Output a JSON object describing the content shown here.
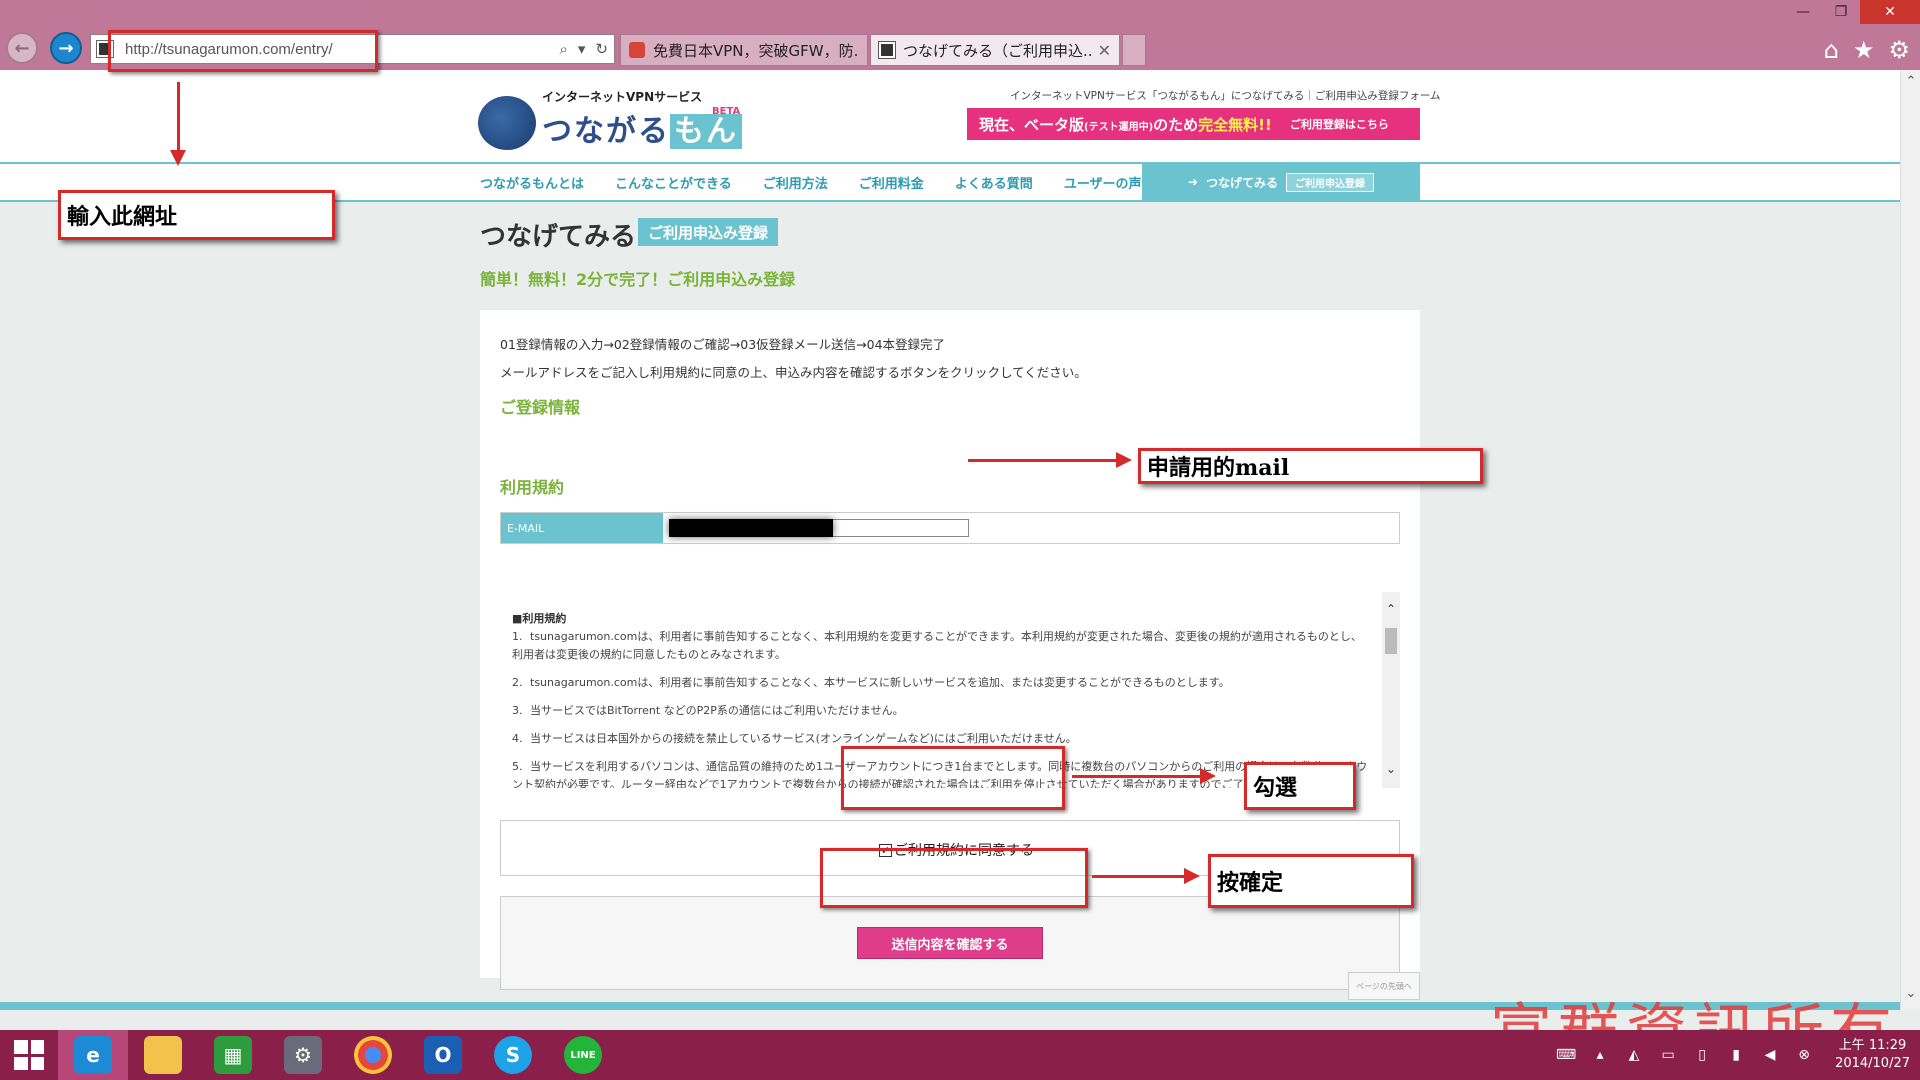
{
  "browser": {
    "url": "http://tsunagarumon.com/entry/",
    "tabs": [
      {
        "title": "免費日本VPN，突破GFW，防..."
      },
      {
        "title": "つなげてみる（ご利用申込..."
      }
    ],
    "window_controls": {
      "minimize": "—",
      "restore": "❐",
      "close": "✕"
    },
    "icons": [
      "back-icon",
      "forward-icon",
      "search-icon",
      "refresh-icon",
      "home-icon",
      "star-icon",
      "gear-icon"
    ]
  },
  "site": {
    "logo_sub": "インターネットVPNサービス",
    "logo_main_1": "つながる",
    "logo_main_2": "もん",
    "logo_beta": "BETA",
    "breadcrumb": "インターネットVPNサービス「つながるもん」につなげてみる｜ご利用申込み登録フォーム",
    "banner_1": "現在、ベータ版",
    "banner_small": "(テスト運用中)",
    "banner_2": "のため",
    "banner_3": "完全無料!!",
    "banner_link": "ご利用登録はこちら",
    "nav": [
      "つながるもんとは",
      "こんなことができる",
      "ご利用方法",
      "ご利用料金",
      "よくある質問",
      "ユーザーの声"
    ],
    "nav_cta": "つなげてみる",
    "nav_cta_badge": "ご利用申込登録"
  },
  "main": {
    "title": "つなげてみる",
    "title_badge": "ご利用申込み登録",
    "subtitle": "簡単！無料！2分で完了！ご利用申込み登録",
    "steps": "01登録情報の入力→02登録情報のご確認→03仮登録メール送信→04本登録完了",
    "instruction": "メールアドレスをご記入し利用規約に同意の上、申込み内容を確認するボタンをクリックしてください。",
    "section_info": "ご登録情報",
    "email_label": "E-MAIL",
    "section_terms": "利用規約",
    "terms_title": "■利用規約",
    "terms": [
      {
        "num": "1.",
        "text": "tsunagarumon.comは、利用者に事前告知することなく、本利用規約を変更することができます。本利用規約が変更された場合、変更後の規約が適用されるものとし、利用者は変更後の規約に同意したものとみなされます。"
      },
      {
        "num": "2.",
        "text": "tsunagarumon.comは、利用者に事前告知することなく、本サービスに新しいサービスを追加、または変更することができるものとします。"
      },
      {
        "num": "3.",
        "text": "当サービスではBitTorrent などのP2P系の通信にはご利用いただけません。"
      },
      {
        "num": "4.",
        "text": "当サービスは日本国外からの接続を禁止しているサービス(オンラインゲームなど)にはご利用いただけません。"
      },
      {
        "num": "5.",
        "text": "当サービスを利用するパソコンは、通信品質の維持のため1ユーザーアカウントにつき1台までとします。同時に複数台のパソコンからのご利用の場合は、台数分のアカウント契約が必要です。ルーター経由などで1アカウントで複数台からの接続が確認された場合はご利用を停止させていただく場合がありますのでご了承ください。"
      }
    ],
    "agree_label": "ご利用規約に同意する",
    "agree_checked": "✓",
    "submit_label": "送信内容を確認する",
    "pagetop": "ページの先頭へ"
  },
  "annotations": {
    "url_label": "輸入此網址",
    "mail_label": "申請用的mail",
    "check_label": "勾選",
    "confirm_label": "按確定",
    "color": "#d42a2a"
  },
  "watermark": "富群資訊所有",
  "taskbar": {
    "apps": [
      "internet-explorer",
      "file-explorer",
      "store",
      "settings",
      "chrome",
      "outlook",
      "skype",
      "line"
    ],
    "outlook_glyph": "O",
    "skype_glyph": "S",
    "line_glyph": "LINE",
    "clock_time": "上午 11:29",
    "clock_date": "2014/10/27"
  }
}
